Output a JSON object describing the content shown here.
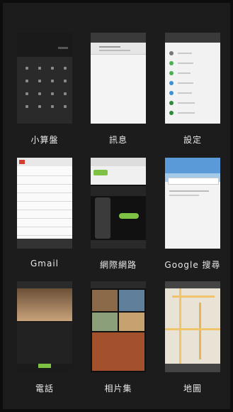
{
  "apps": [
    {
      "label": "小算盤"
    },
    {
      "label": "訊息"
    },
    {
      "label": "設定"
    },
    {
      "label": "Gmail"
    },
    {
      "label": "網際網路"
    },
    {
      "label": "Google 搜尋"
    },
    {
      "label": "電話"
    },
    {
      "label": "相片集"
    },
    {
      "label": "地圖"
    }
  ],
  "colors": {
    "background": "#0d0d0d",
    "panel": "#1c1c1c",
    "htc_green": "#7dc242",
    "google_search_blue": "#5a9ad8",
    "settings_green": "#4caf50"
  }
}
